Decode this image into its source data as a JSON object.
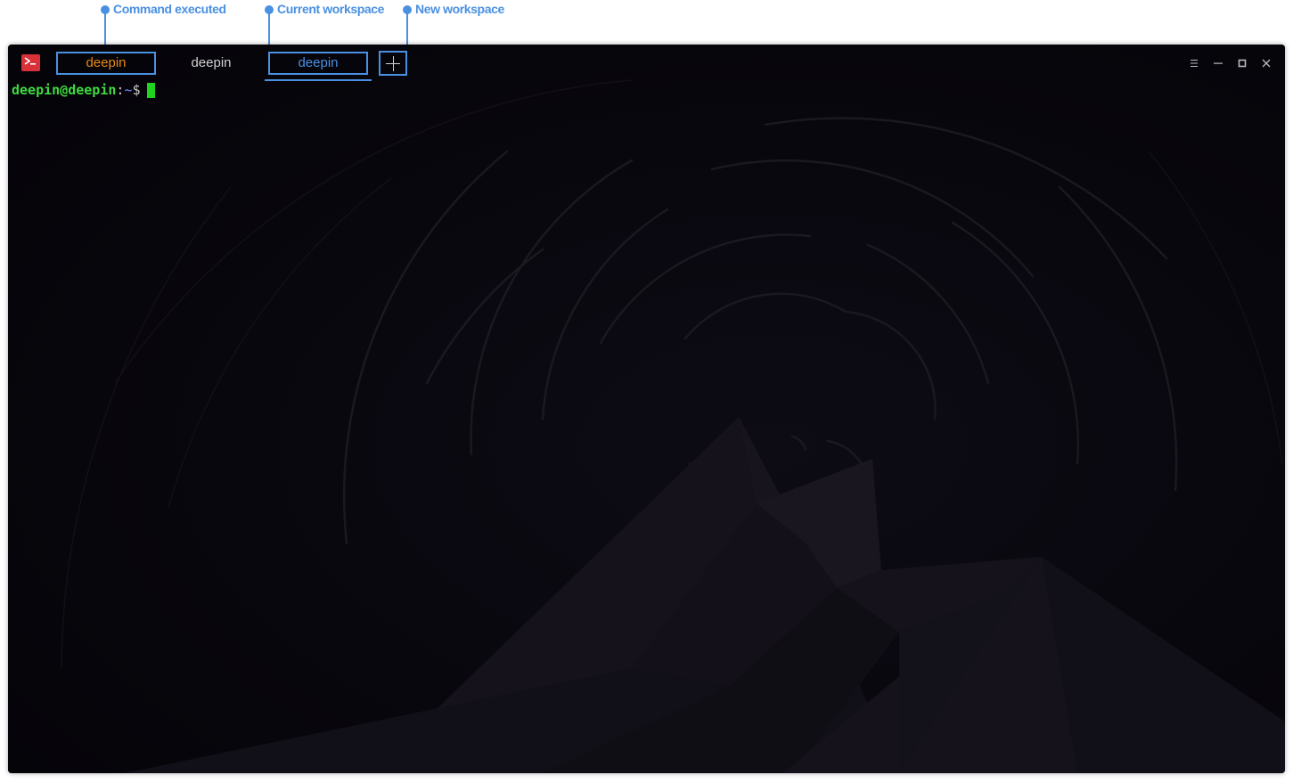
{
  "annotations": {
    "command_executed": "Command executed",
    "current_workspace": "Current workspace",
    "new_workspace": "New workspace"
  },
  "window": {
    "app_icon": "terminal-icon",
    "tabs": [
      {
        "label": "deepin",
        "state": "command-executed",
        "color": "#e8891a"
      },
      {
        "label": "deepin",
        "state": "normal",
        "color": "#d0d0d0"
      },
      {
        "label": "deepin",
        "state": "active",
        "color": "#4a90e2"
      }
    ],
    "new_tab_icon": "plus-icon",
    "controls": [
      "menu-icon",
      "minimize-icon",
      "maximize-icon",
      "close-icon"
    ]
  },
  "terminal": {
    "user_host": "deepin@deepin",
    "separator": ":",
    "path": "~",
    "symbol": "$ "
  },
  "colors": {
    "accent": "#4a90e2",
    "prompt_user": "#3fd93f",
    "cursor": "#1fd31f",
    "background": "#07060d"
  }
}
